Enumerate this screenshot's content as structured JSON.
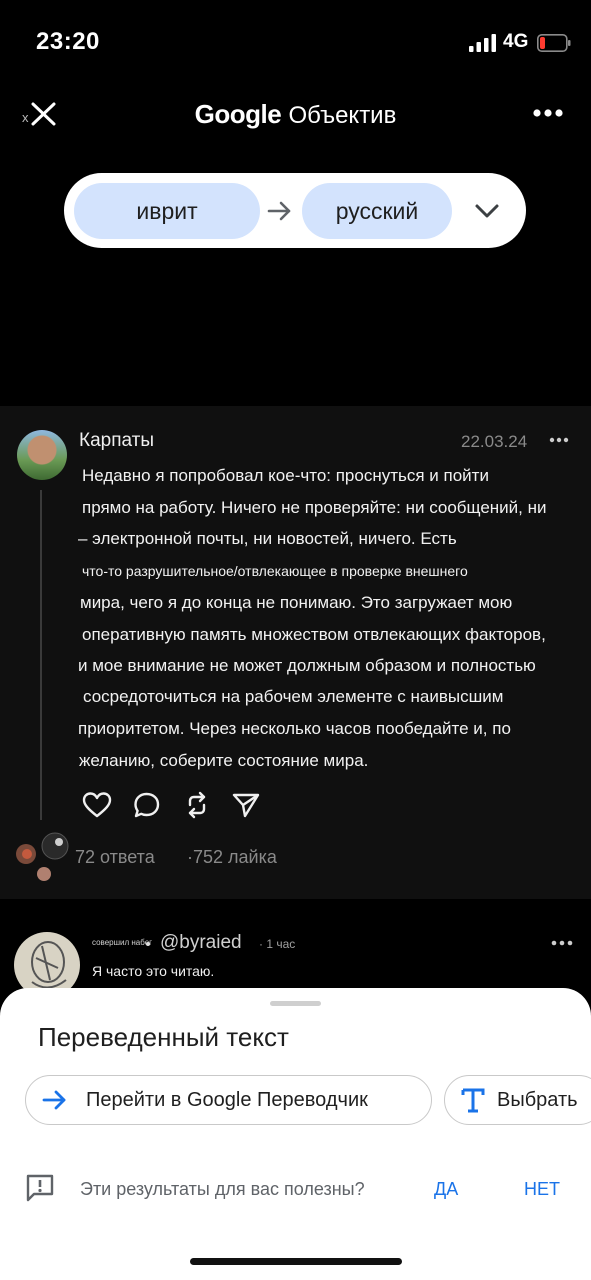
{
  "status_bar": {
    "time": "23:20",
    "network": "4G"
  },
  "header": {
    "title_brand": "Google",
    "title_product": "Объектив"
  },
  "language": {
    "source": "иврит",
    "target": "русский"
  },
  "post": {
    "author": "Карпаты",
    "date": "22.03.24",
    "lines": [
      "Недавно я попробовал кое-что: проснуться и пойти",
      "прямо на работу. Ничего не проверяйте: ни сообщений, ни",
      "– электронной почты, ни новостей, ничего. Есть",
      "что-то разрушительное/отвлекающее в проверке внешнего",
      "мира, чего я до конца не понимаю. Это загружает мою",
      "оперативную память множеством отвлекающих факторов,",
      "и мое внимание не может должным образом и полностью",
      "сосредоточиться на рабочем элементе с наивысшим",
      "приоритетом. Через несколько часов пообедайте и, по",
      "желанию, соберите состояние мира."
    ],
    "replies": "72 ответа",
    "likes": "752 лайка"
  },
  "reply": {
    "raid_label": "совершил набег",
    "handle": "@byraied",
    "time": "1 час",
    "text": "Я часто это читаю."
  },
  "sheet": {
    "title": "Переведенный текст",
    "translate_chip": "Перейти в Google Переводчик",
    "select_chip": "Выбрать",
    "feedback_question": "Эти результаты для вас полезны?",
    "yes": "ДА",
    "no": "НЕТ"
  },
  "colors": {
    "accent_blue": "#1a73e8",
    "chip_blue": "#d3e3fd"
  }
}
